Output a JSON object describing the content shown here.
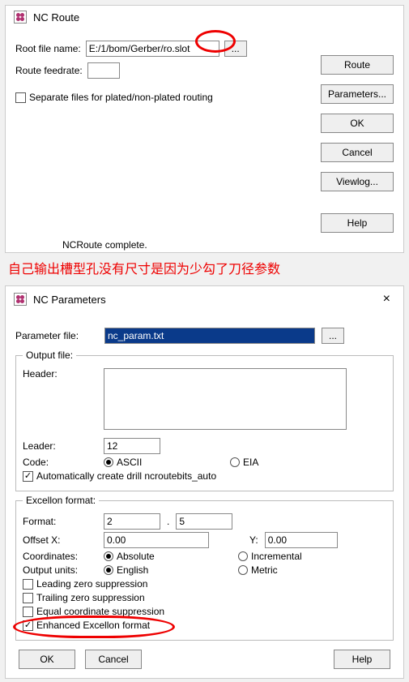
{
  "window1": {
    "title": "NC Route",
    "rootFileLabel": "Root file name:",
    "rootFileValue": "E:/1/bom/Gerber/ro.slot",
    "feedrateLabel": "Route feedrate:",
    "feedrateValue": "",
    "browseBtn": "...",
    "separateLabel": "Separate files for plated/non-plated routing",
    "buttons": {
      "route": "Route",
      "parameters": "Parameters...",
      "ok": "OK",
      "cancel": "Cancel",
      "viewlog": "Viewlog...",
      "help": "Help"
    },
    "status": "NCRoute complete."
  },
  "annotation": "自己输出槽型孔没有尺寸是因为少勾了刀径参数",
  "window2": {
    "title": "NC Parameters",
    "paramFileLabel": "Parameter file:",
    "paramFileValue": "nc_param.txt",
    "browseBtn": "...",
    "outputFileGroup": "Output file:",
    "headerLabel": "Header:",
    "headerValue": "",
    "leaderLabel": "Leader:",
    "leaderValue": "12",
    "codeLabel": "Code:",
    "codeASCII": "ASCII",
    "codeEIA": "EIA",
    "autoCreateLabel": "Automatically create drill ncroutebits_auto",
    "excellonGroup": "Excellon format:",
    "formatLabel": "Format:",
    "formatA": "2",
    "formatSep": ".",
    "formatB": "5",
    "offsetXLabel": "Offset X:",
    "offsetXValue": "0.00",
    "offsetYLabel": "Y:",
    "offsetYValue": "0.00",
    "coordLabel": "Coordinates:",
    "coordAbs": "Absolute",
    "coordInc": "Incremental",
    "unitsLabel": "Output units:",
    "unitsEng": "English",
    "unitsMet": "Metric",
    "leadingZero": "Leading zero suppression",
    "trailingZero": "Trailing zero suppression",
    "equalCoord": "Equal coordinate suppression",
    "enhanced": "Enhanced Excellon format",
    "buttons": {
      "ok": "OK",
      "cancel": "Cancel",
      "help": "Help"
    }
  }
}
